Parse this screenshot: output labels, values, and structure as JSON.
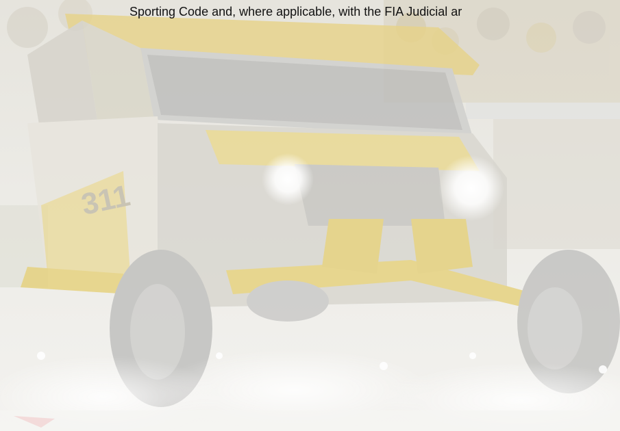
{
  "document": {
    "text_line": "Sporting Code and, where applicable, with the FIA Judicial ar"
  },
  "background_image": {
    "subject": "off-road-buggy-photo",
    "race_number": "311"
  }
}
